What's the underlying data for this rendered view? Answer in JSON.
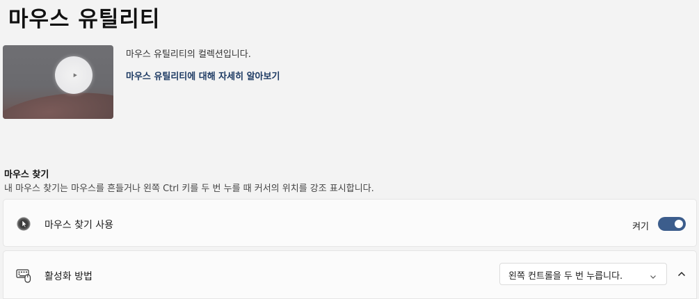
{
  "page": {
    "title": "마우스 유틸리티"
  },
  "hero": {
    "description": "마우스 유틸리티의 컬렉션입니다.",
    "learn_more": "마우스 유틸리티에 대해 자세히 알아보기"
  },
  "find_my_mouse": {
    "title": "마우스 찾기",
    "description": "내 마우스 찾기는 마우스를 흔들거나 왼쪽 Ctrl 키를 두 번 누를 때 커서의 위치를 강조 표시합니다.",
    "enable": {
      "icon": "mouse-pointer-icon",
      "label": "마우스 찾기 사용",
      "state_label": "켜기",
      "enabled": true,
      "accent_color": "#3c5d8c"
    },
    "activation": {
      "icon": "keyboard-mouse-icon",
      "label": "활성화 방법",
      "selected": "왼쪽 컨트롤을 두 번 누릅니다.",
      "expanded": true
    }
  }
}
